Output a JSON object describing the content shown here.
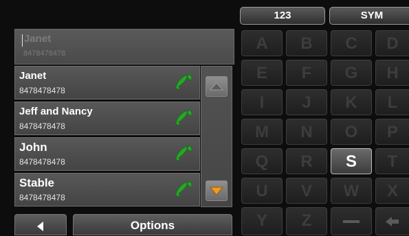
{
  "search": {
    "text": "Janet",
    "number": "8478478478"
  },
  "contacts": [
    {
      "name": "Janet",
      "number": "8478478478"
    },
    {
      "name": "Jeff and Nancy",
      "number": "8478478478"
    },
    {
      "name": "John",
      "number": "8478478478"
    },
    {
      "name": "Stable",
      "number": "8478478478"
    }
  ],
  "bottom": {
    "back_icon": "triangle-left-icon",
    "options_label": "Options"
  },
  "keyboard": {
    "tab_numbers": "123",
    "tab_symbols": "SYM",
    "keys": [
      "A",
      "B",
      "C",
      "D",
      "E",
      "F",
      "G",
      "H",
      "I",
      "J",
      "K",
      "L",
      "M",
      "N",
      "O",
      "P",
      "Q",
      "R",
      "S",
      "T",
      "U",
      "V",
      "W",
      "X",
      "Y",
      "Z"
    ],
    "active_key": "S",
    "space_icon": "space-bar-icon",
    "backspace_icon": "backspace-arrow-icon"
  },
  "colors": {
    "phone_icon": "#2ea12e",
    "scroll_down_arrow": "#f39b1e"
  }
}
